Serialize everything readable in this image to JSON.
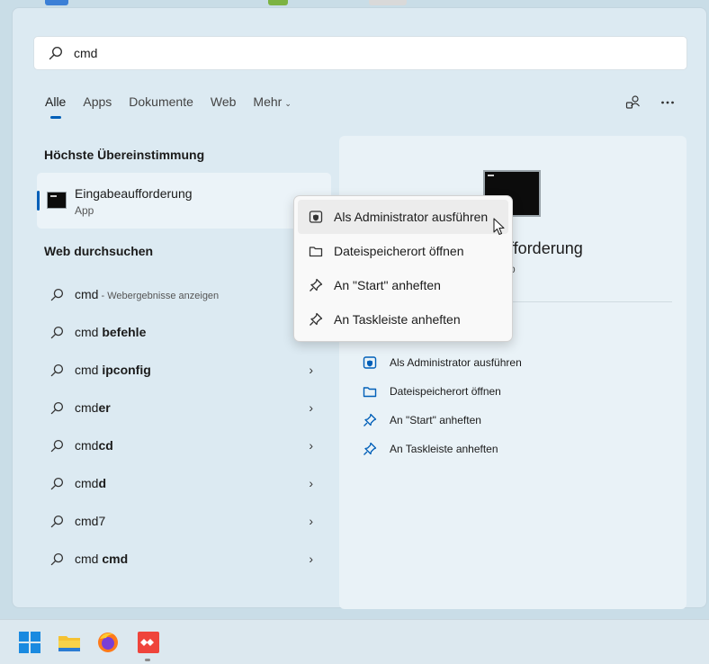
{
  "search": {
    "value": "cmd"
  },
  "tabs": [
    {
      "label": "Alle"
    },
    {
      "label": "Apps"
    },
    {
      "label": "Dokumente"
    },
    {
      "label": "Web"
    },
    {
      "label": "Mehr"
    }
  ],
  "best_match": {
    "heading": "Höchste Übereinstimmung",
    "title": "Eingabeaufforderung",
    "subtitle": "App"
  },
  "web": {
    "heading": "Web durchsuchen",
    "items": [
      {
        "normal": "cmd",
        "bold": "",
        "hint": " - Webergebnisse anzeigen"
      },
      {
        "normal": "cmd ",
        "bold": "befehle",
        "hint": ""
      },
      {
        "normal": "cmd ",
        "bold": "ipconfig",
        "hint": ""
      },
      {
        "normal": "cmd",
        "bold": "er",
        "hint": ""
      },
      {
        "normal": "cmd",
        "bold": "cd",
        "hint": ""
      },
      {
        "normal": "cmd",
        "bold": "d",
        "hint": ""
      },
      {
        "normal": "cmd7",
        "bold": "",
        "hint": ""
      },
      {
        "normal": "cmd ",
        "bold": "cmd",
        "hint": ""
      }
    ]
  },
  "detail": {
    "title": "fforderung",
    "subtitle": "p",
    "actions": [
      {
        "label": "Als Administrator ausführen"
      },
      {
        "label": "Dateispeicherort öffnen"
      },
      {
        "label": "An \"Start\" anheften"
      },
      {
        "label": "An Taskleiste anheften"
      }
    ]
  },
  "context_menu": {
    "items": [
      {
        "label": "Als Administrator ausführen"
      },
      {
        "label": "Dateispeicherort öffnen"
      },
      {
        "label": "An \"Start\" anheften"
      },
      {
        "label": "An Taskleiste anheften"
      }
    ]
  },
  "colors": {
    "accent": "#005fb8"
  }
}
